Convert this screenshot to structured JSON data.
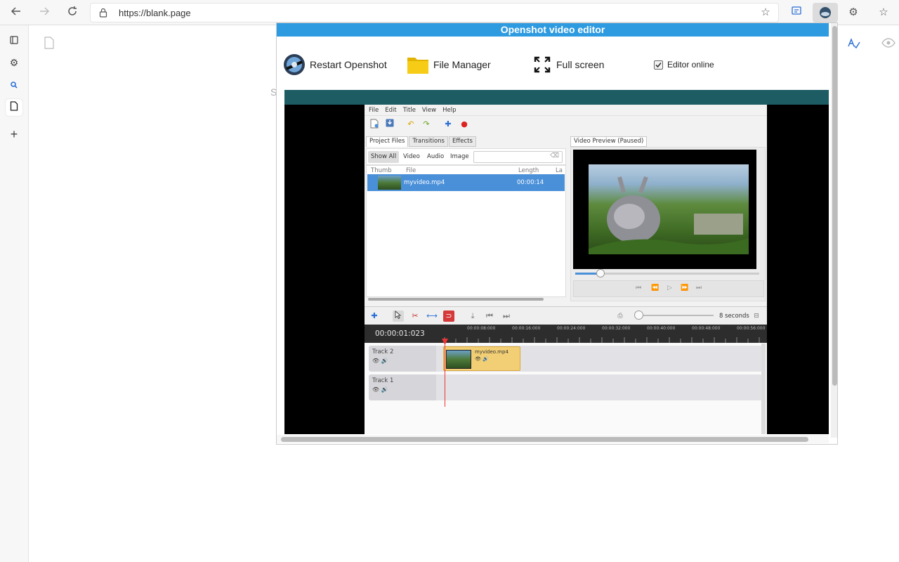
{
  "browser": {
    "url": "https://blank.page",
    "icons": [
      "back-icon",
      "forward-icon",
      "reload-icon",
      "lock-icon",
      "favorite-add-icon",
      "collections-icon",
      "profile-icon",
      "extensions-icon",
      "favorites-icon"
    ]
  },
  "sidebar": {
    "icons": [
      "tab-actions-icon",
      "extension-icon",
      "search-icon",
      "page-icon",
      "add-icon"
    ]
  },
  "popup": {
    "title": "Openshot video editor",
    "buttons": {
      "restart": "Restart Openshot",
      "file_manager": "File Manager",
      "full_screen": "Full screen"
    },
    "editor_online": {
      "label": "Editor online",
      "checked": true
    },
    "stray_letter": "S"
  },
  "openshot": {
    "menu": [
      "File",
      "Edit",
      "Title",
      "View",
      "Help"
    ],
    "tabs": [
      "Project Files",
      "Transitions",
      "Effects"
    ],
    "filters": [
      "Show All",
      "Video",
      "Audio",
      "Image"
    ],
    "columns": {
      "thumb": "Thumb",
      "file": "File",
      "length": "Length",
      "label": "La"
    },
    "files": [
      {
        "name": "myvideo.mp4",
        "length": "00:00:14"
      }
    ],
    "preview_tab": "Video Preview (Paused)",
    "zoom_label": "8 seconds",
    "timecode": "00:00:01:023",
    "ruler_labels": [
      "00:00:08:000",
      "00:00:16:000",
      "00:00:24:000",
      "00:00:32:000",
      "00:00:40:000",
      "00:00:48:000",
      "00:00:56:000"
    ],
    "tracks": [
      {
        "name": "Track 2",
        "clip": "myvideo.mp4"
      },
      {
        "name": "Track 1",
        "clip": ""
      }
    ]
  },
  "colors": {
    "title_bar": "#2e9be0",
    "teal_bar": "#1d5c63",
    "selection": "#4a90d9",
    "clip": "#f2cf74",
    "playhead": "#e33333"
  }
}
